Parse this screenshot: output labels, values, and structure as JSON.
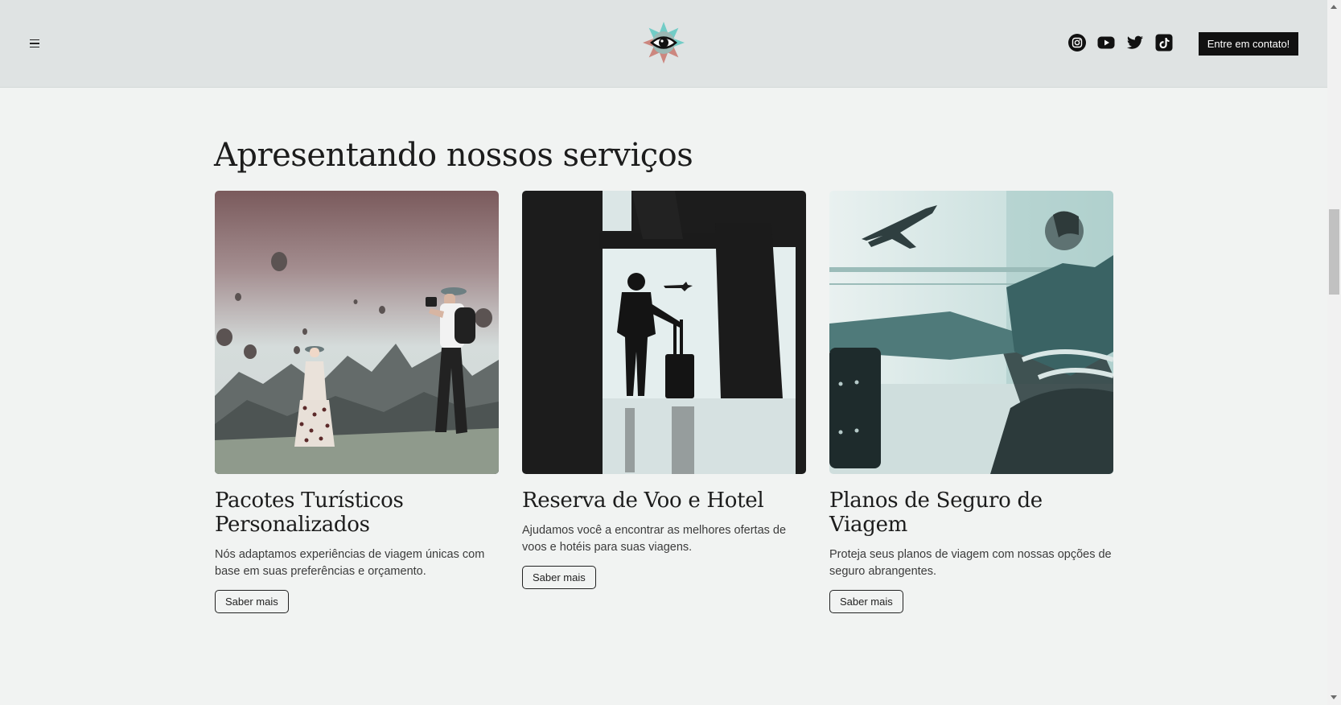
{
  "header": {
    "menu_icon": "hamburger-menu-icon",
    "logo_icon": "eye-flower-logo",
    "social": [
      {
        "name": "instagram-icon"
      },
      {
        "name": "youtube-icon"
      },
      {
        "name": "twitter-icon"
      },
      {
        "name": "tiktok-icon"
      }
    ],
    "cta_label": "Entre em contato!"
  },
  "section": {
    "title": "Apresentando nossos serviços"
  },
  "cards": [
    {
      "title": "Pacotes Turísticos Personalizados",
      "description": "Nós adaptamos experiências de viagem únicas com base em suas preferências e orçamento.",
      "button": "Saber mais",
      "image": "hot-air-balloons-travelers-photo"
    },
    {
      "title": "Reserva de Voo e Hotel",
      "description": "Ajudamos você a encontrar as melhores ofertas de voos e hotéis para suas viagens.",
      "button": "Saber mais",
      "image": "airport-window-silhouette-photo"
    },
    {
      "title": "Planos de Seguro de Viagem",
      "description": "Proteja seus planos de viagem com nossas opções de seguro abrangentes.",
      "button": "Saber mais",
      "image": "man-waiting-airport-photo"
    }
  ],
  "colors": {
    "header_bg": "#dfe3e3",
    "page_bg": "#f1f3f2",
    "cta_bg": "#111111",
    "logo_teal": "#5fc9c2",
    "logo_rose": "#c9786e"
  }
}
